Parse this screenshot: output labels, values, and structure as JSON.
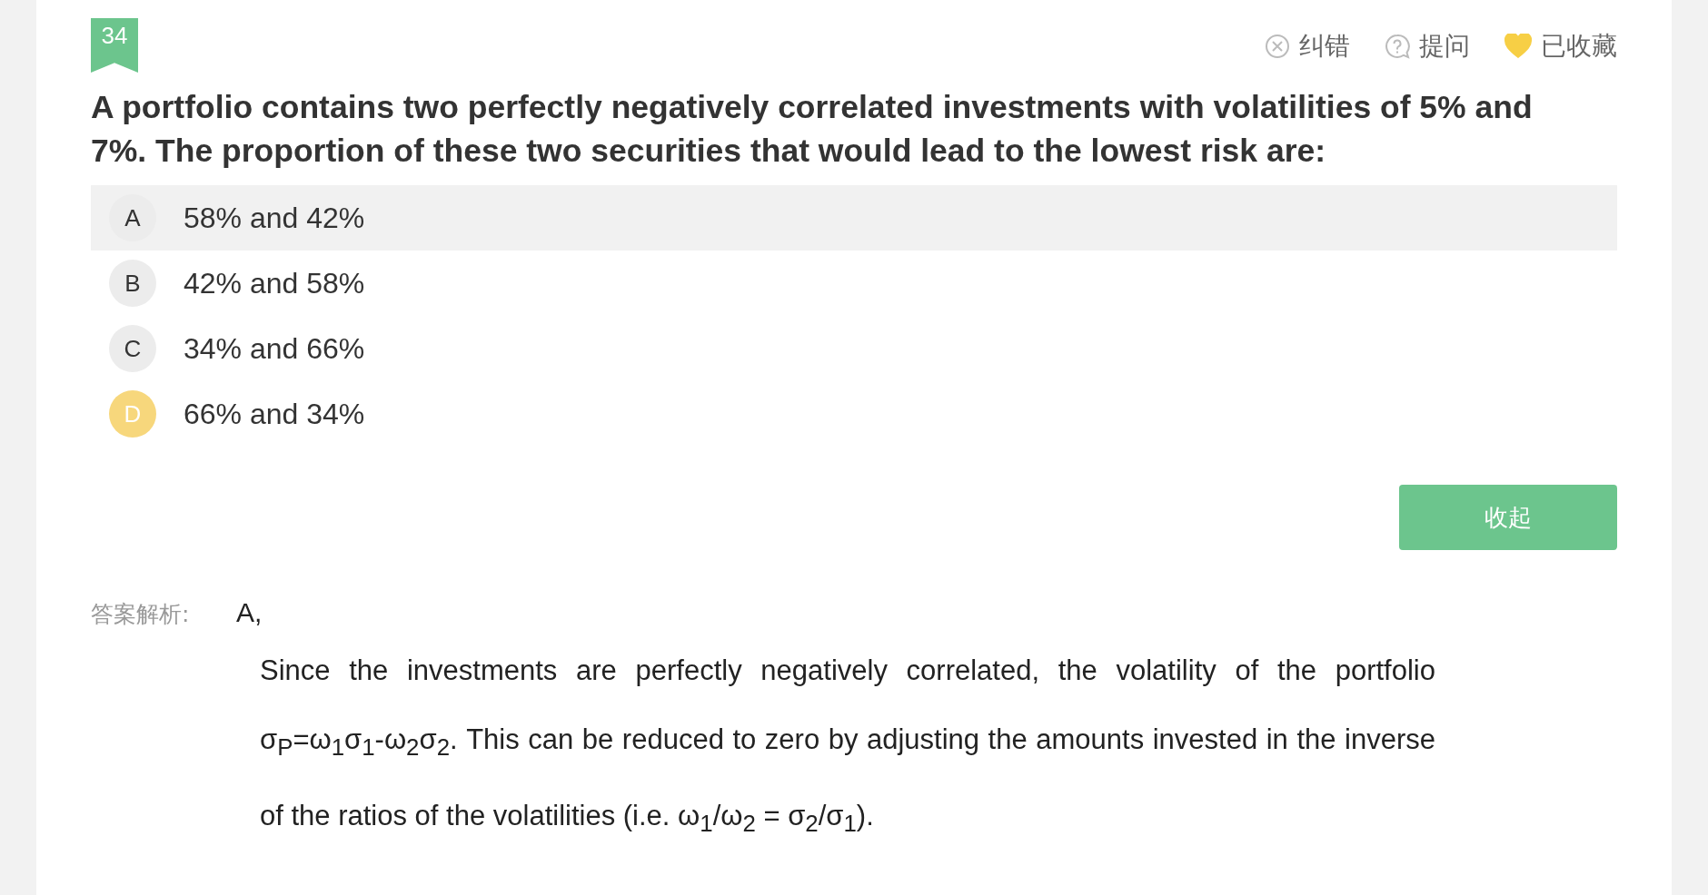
{
  "question": {
    "number": "34",
    "text": "A portfolio contains two perfectly negatively correlated investments with volatilities of 5% and 7%. The proportion of these two securities that would lead to the lowest risk are:"
  },
  "actions": [
    {
      "kind": "report",
      "label": "纠错"
    },
    {
      "kind": "ask",
      "label": "提问"
    },
    {
      "kind": "favorite",
      "label": "已收藏",
      "on": true
    }
  ],
  "options": [
    {
      "letter": "A",
      "text": "58% and 42%",
      "highlighted": true,
      "selected": false
    },
    {
      "letter": "B",
      "text": "42% and 58%",
      "highlighted": false,
      "selected": false
    },
    {
      "letter": "C",
      "text": "34% and 66%",
      "highlighted": false,
      "selected": false
    },
    {
      "letter": "D",
      "text": "66% and 34%",
      "highlighted": false,
      "selected": true
    }
  ],
  "collapse_button": "收起",
  "analysis": {
    "label": "答案解析:",
    "answer": "A,",
    "explanation": "Since the investments are perfectly negatively correlated, the volatility of the portfolio σ$_{P}$=ω$_{1}$σ$_{1}$-ω$_{2}$σ$_{2}$. This can be reduced to zero by adjusting the amounts invested in the inverse of the ratios of the volatilities (i.e. ω$_{1}$/ω$_{2}$ = σ$_{2}$/σ$_{1}$)."
  }
}
